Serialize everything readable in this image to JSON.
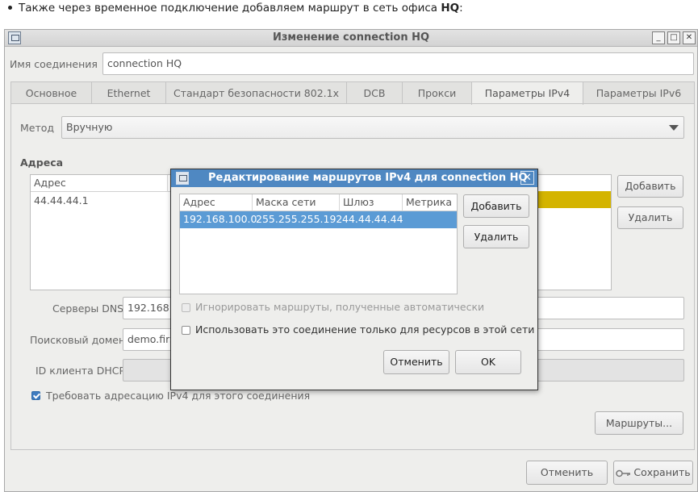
{
  "doc": {
    "text_before": "Также через временное подключение добавляем маршрут в сеть офиса ",
    "text_bold": "HQ",
    "text_after": ":"
  },
  "window": {
    "title": "Изменение connection HQ",
    "minimize": "_",
    "maximize": "□",
    "close": "✕"
  },
  "connection_name": {
    "label": "Имя соединения",
    "value": "connection HQ"
  },
  "tabs": [
    {
      "label": "Основное",
      "active": false
    },
    {
      "label": "Ethernet",
      "active": false
    },
    {
      "label": "Стандарт безопасности 802.1x",
      "active": false
    },
    {
      "label": "DCB",
      "active": false
    },
    {
      "label": "Прокси",
      "active": false
    },
    {
      "label": "Параметры IPv4",
      "active": true
    },
    {
      "label": "Параметры IPv6",
      "active": false
    }
  ],
  "ipv4": {
    "method_label": "Метод",
    "method_value": "Вручную",
    "addresses_heading": "Адреса",
    "addresses_table": {
      "col_address": "Адрес",
      "rows": [
        {
          "address": "44.44.44.1"
        }
      ]
    },
    "add_button": "Добавить",
    "delete_button": "Удалить",
    "dns_label": "Серверы DNS",
    "dns_value": "192.168.1",
    "search_label": "Поисковый домен",
    "search_value": "demo.firs",
    "dhcp_label": "ID клиента DHCP",
    "dhcp_value": "",
    "require_ipv4_label": "Требовать адресацию IPv4 для этого соединения",
    "require_ipv4_checked": true,
    "routes_button": "Маршруты..."
  },
  "footer": {
    "cancel": "Отменить",
    "save": "Сохранить"
  },
  "dialog": {
    "title": "Редактирование маршрутов IPv4 для connection HQ",
    "close": "✕",
    "columns": {
      "address": "Адрес",
      "netmask": "Маска сети",
      "gateway": "Шлюз",
      "metric": "Метрика"
    },
    "rows": [
      {
        "address": "192.168.100.0",
        "netmask": "255.255.255.192",
        "gateway": "44.44.44.44",
        "metric": ""
      }
    ],
    "add_button": "Добавить",
    "delete_button": "Удалить",
    "ignore_auto_routes": "Игнорировать маршруты, полученные автоматически",
    "ignore_auto_routes_enabled": false,
    "only_local_resources": "Использовать это соединение только для ресурсов в этой сети",
    "only_local_resources_checked": false,
    "cancel": "Отменить",
    "ok": "OK"
  },
  "colors": {
    "accent": "#4f88c2",
    "selection": "#5b9bd5",
    "highlight": "#d4b400"
  },
  "icons": {
    "window": "network-window-icon",
    "dropdown": "chevron-down-icon",
    "key": "key-icon",
    "check": "check-icon"
  }
}
